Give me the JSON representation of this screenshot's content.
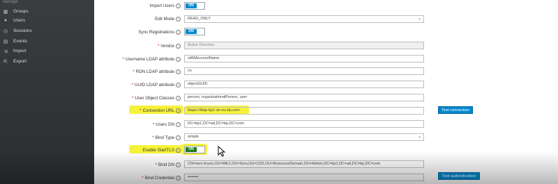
{
  "sidebar": {
    "cut_label": "Manage",
    "items": [
      {
        "label": "Groups",
        "icon": "groups-icon"
      },
      {
        "label": "Users",
        "icon": "users-icon"
      },
      {
        "label": "Sessions",
        "icon": "sessions-icon"
      },
      {
        "label": "Events",
        "icon": "events-icon"
      },
      {
        "label": "Import",
        "icon": "import-icon"
      },
      {
        "label": "Export",
        "icon": "export-icon"
      }
    ]
  },
  "form": {
    "import_users": {
      "label": "Import Users",
      "value": "ON"
    },
    "edit_mode": {
      "label": "Edit Mode",
      "value": "READ_ONLY"
    },
    "sync_registrations": {
      "label": "Sync Registrations",
      "value": "ON"
    },
    "vendor": {
      "label": "Vendor",
      "value": "Active Directory"
    },
    "username_ldap": {
      "label": "Username LDAP attribute",
      "value": "sAMAccountName"
    },
    "rdn_ldap": {
      "label": "RDN LDAP attribute",
      "value": "cn"
    },
    "uuid_ldap": {
      "label": "UUID LDAP attribute",
      "value": "objectGUID"
    },
    "user_object_classes": {
      "label": "User Object Classes",
      "value": "person, organizationalPerson, user"
    },
    "connection_url": {
      "label": "Connection URL",
      "value": "ldaps://ldap-bp1-an-eu.bp.com",
      "button": "Test connection"
    },
    "users_dn": {
      "label": "Users DN",
      "value": "DC=bp1,DC=ad,DC=bp,DC=com"
    },
    "bind_type": {
      "label": "Bind Type",
      "value": "simple"
    },
    "enable_starttls": {
      "label": "Enable StartTLS",
      "value": "ON"
    },
    "bind_dn": {
      "label": "Bind DN",
      "value": "CN=serv-kryon,OU=WE1,OU=Serv,OU=CD2,OU=ResourceDomain,OU=Admin,DC=bp1,DC=ad,DC=bp,DC=com"
    },
    "bind_credential": {
      "label": "Bind Credential",
      "value": "••••••••",
      "button": "Test authentication"
    }
  },
  "colors": {
    "primary": "#0088ce",
    "toggle_on_green": "#1f7a1f",
    "highlight": "#f6f23a",
    "sidebar": "#2f3235"
  }
}
